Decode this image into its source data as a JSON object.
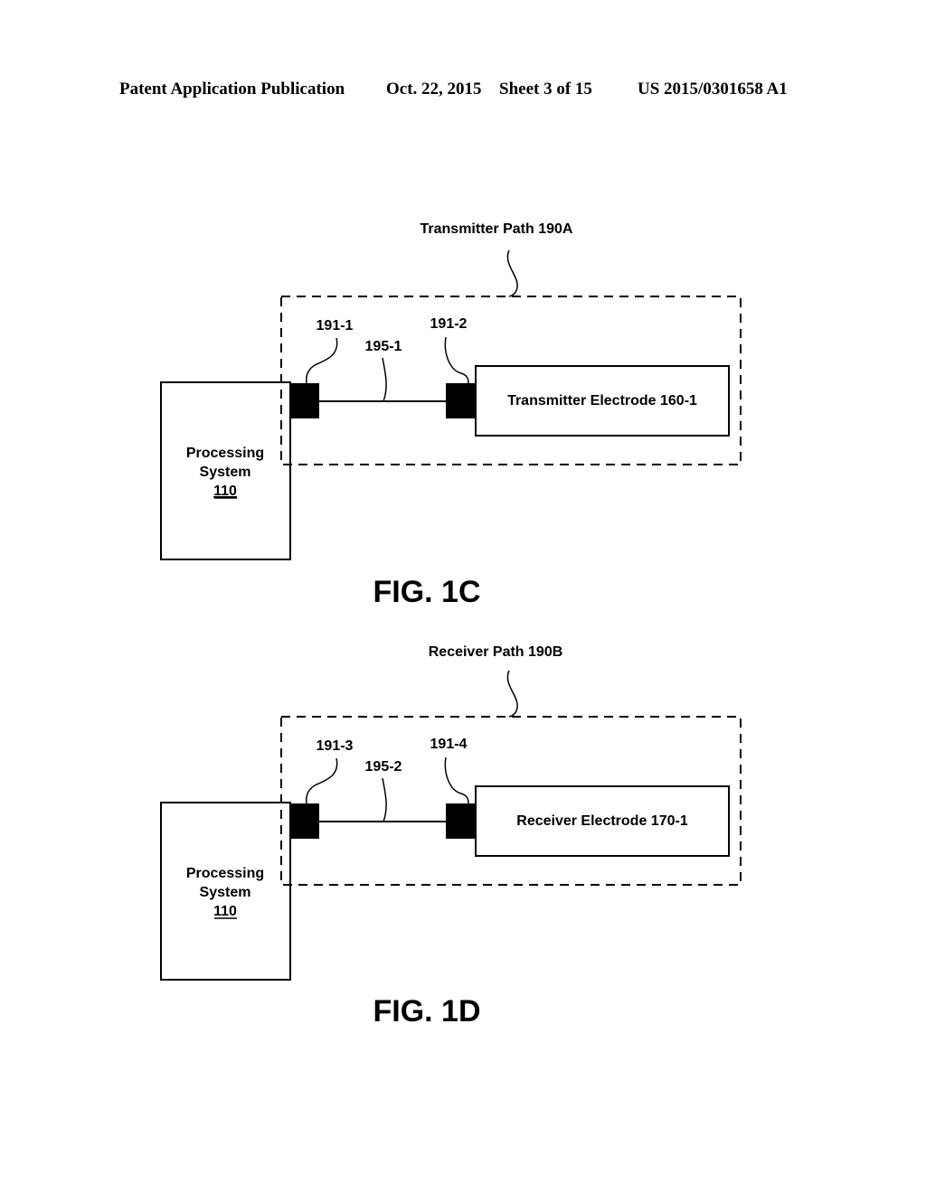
{
  "header": {
    "publication": "Patent Application Publication",
    "date": "Oct. 22, 2015",
    "sheet": "Sheet 3 of 15",
    "number": "US 2015/0301658 A1"
  },
  "figures": [
    {
      "caption": "FIG. 1C",
      "path_label": "Transmitter Path 190A",
      "processing_system": {
        "line1": "Processing",
        "line2": "System",
        "ref": "110"
      },
      "connector_a": "191-1",
      "connector_b": "191-2",
      "trace": "195-1",
      "electrode": "Transmitter Electrode 160-1"
    },
    {
      "caption": "FIG. 1D",
      "path_label": "Receiver Path 190B",
      "processing_system": {
        "line1": "Processing",
        "line2": "System",
        "ref": "110"
      },
      "connector_a": "191-3",
      "connector_b": "191-4",
      "trace": "195-2",
      "electrode": "Receiver Electrode 170-1"
    }
  ]
}
